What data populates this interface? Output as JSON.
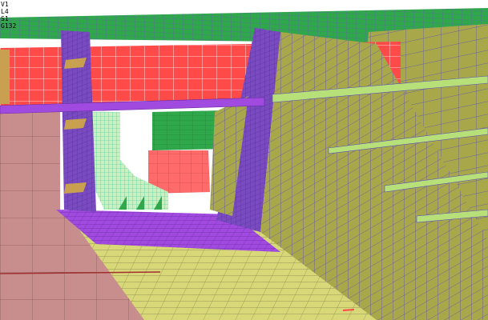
{
  "viewport": {
    "info_lines": [
      "V1",
      "L4",
      "S1",
      "G132"
    ],
    "colors": {
      "background": "#ffffff",
      "red_mesh": "#ff4a4a",
      "olive_mesh": "#a8a84a",
      "green_mesh": "#2ea84a",
      "magenta_mesh": "#a04ae0",
      "purple_dark": "#6a3ab0",
      "pink_mesh": "#c88e8e",
      "yellow_mesh": "#d8d878",
      "tan_mesh": "#c8a050",
      "cyan_mesh": "#8aeec8",
      "mesh_line_light": "#ffffff",
      "mesh_line_dark": "#5a4ab8"
    }
  }
}
